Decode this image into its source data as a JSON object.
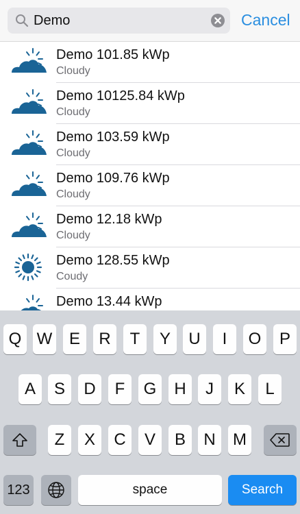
{
  "search": {
    "value": "Demo",
    "cancel_label": "Cancel"
  },
  "results": [
    {
      "title": "Demo 101.85 kWp",
      "subtitle": "Cloudy",
      "icon": "partly-cloudy-icon"
    },
    {
      "title": "Demo 10125.84 kWp",
      "subtitle": "Cloudy",
      "icon": "partly-cloudy-icon"
    },
    {
      "title": "Demo 103.59 kWp",
      "subtitle": "Cloudy",
      "icon": "partly-cloudy-icon"
    },
    {
      "title": "Demo 109.76 kWp",
      "subtitle": "Cloudy",
      "icon": "partly-cloudy-icon"
    },
    {
      "title": "Demo 12.18 kWp",
      "subtitle": "Cloudy",
      "icon": "partly-cloudy-icon"
    },
    {
      "title": "Demo 128.55 kWp",
      "subtitle": "Coudy",
      "icon": "sun-icon"
    },
    {
      "title": "Demo 13.44 kWp",
      "subtitle": "",
      "icon": "partly-cloudy-icon"
    }
  ],
  "keyboard": {
    "row1": [
      "Q",
      "W",
      "E",
      "R",
      "T",
      "Y",
      "U",
      "I",
      "O",
      "P"
    ],
    "row2": [
      "A",
      "S",
      "D",
      "F",
      "G",
      "H",
      "J",
      "K",
      "L"
    ],
    "row3": [
      "Z",
      "X",
      "C",
      "V",
      "B",
      "N",
      "M"
    ],
    "numbers_label": "123",
    "space_label": "space",
    "search_label": "Search"
  },
  "colors": {
    "accent": "#2a8ee0",
    "icon_blue": "#1a6496",
    "search_key": "#1a8cf2"
  }
}
